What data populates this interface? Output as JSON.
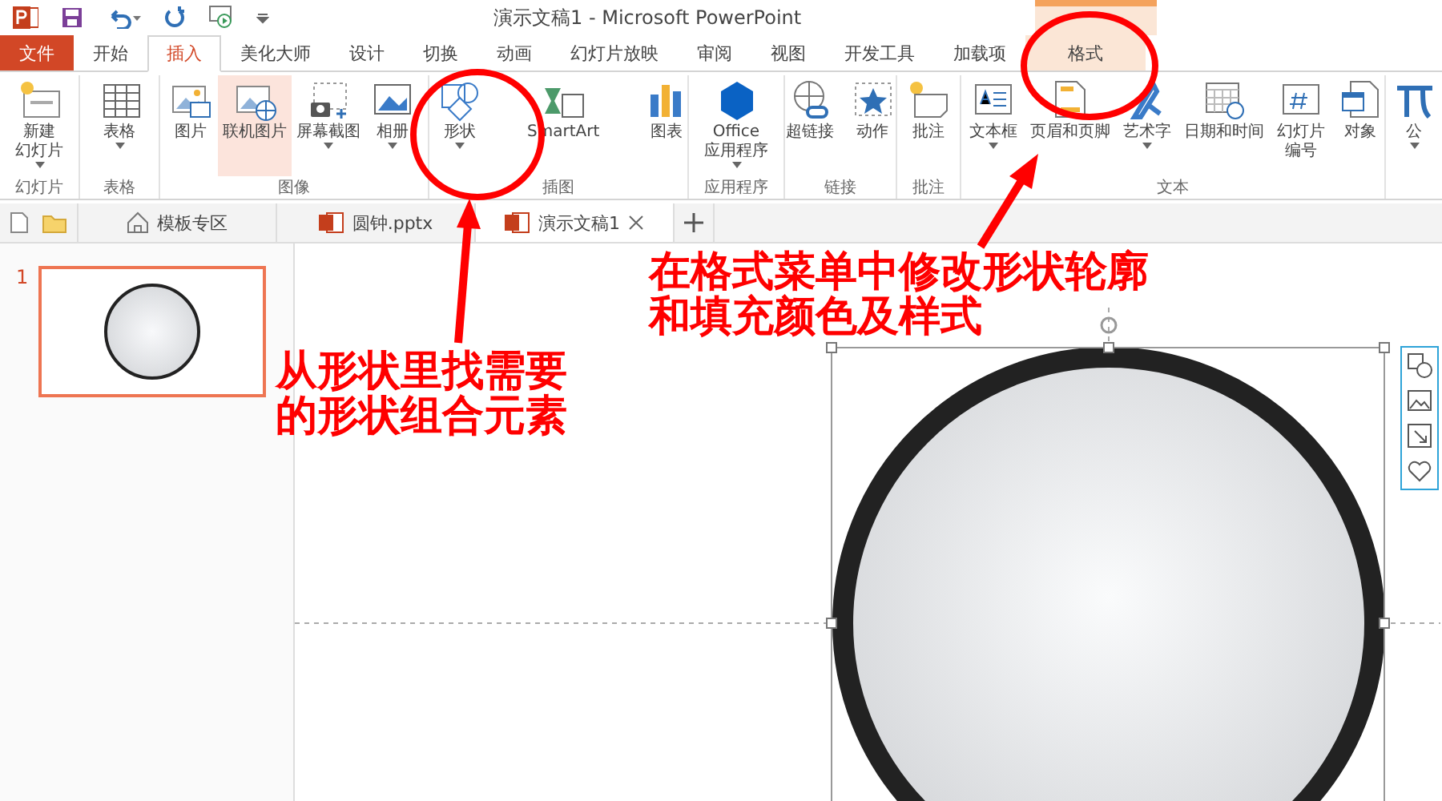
{
  "title_bar": {
    "title": "演示文稿1 - Microsoft PowerPoint"
  },
  "tabs": [
    {
      "label": "文件",
      "kind": "file",
      "selected": false
    },
    {
      "label": "开始",
      "kind": "normal",
      "selected": false
    },
    {
      "label": "插入",
      "kind": "normal",
      "selected": true
    },
    {
      "label": "美化大师",
      "kind": "normal",
      "selected": false
    },
    {
      "label": "设计",
      "kind": "normal",
      "selected": false
    },
    {
      "label": "切换",
      "kind": "normal",
      "selected": false
    },
    {
      "label": "动画",
      "kind": "normal",
      "selected": false
    },
    {
      "label": "幻灯片放映",
      "kind": "normal",
      "selected": false
    },
    {
      "label": "审阅",
      "kind": "normal",
      "selected": false
    },
    {
      "label": "视图",
      "kind": "normal",
      "selected": false
    },
    {
      "label": "开发工具",
      "kind": "normal",
      "selected": false
    },
    {
      "label": "加载项",
      "kind": "normal",
      "selected": false
    },
    {
      "label": "格式",
      "kind": "contextual",
      "selected": false
    }
  ],
  "ribbon_groups": [
    {
      "label": "幻灯片",
      "buttons": [
        {
          "label_lines": [
            "新建",
            "幻灯片"
          ],
          "kind": "new-slide",
          "dropdown": true,
          "highlighted": false
        }
      ]
    },
    {
      "label": "表格",
      "buttons": [
        {
          "label_lines": [
            "表格"
          ],
          "kind": "table",
          "dropdown": true,
          "highlighted": false
        }
      ]
    },
    {
      "label": "图像",
      "buttons": [
        {
          "label_lines": [
            "图片"
          ],
          "kind": "picture",
          "dropdown": false,
          "highlighted": false
        },
        {
          "label_lines": [
            "联机图片"
          ],
          "kind": "online-picture",
          "dropdown": false,
          "highlighted": true
        },
        {
          "label_lines": [
            "屏幕截图"
          ],
          "kind": "screenshot",
          "dropdown": true,
          "highlighted": false
        },
        {
          "label_lines": [
            "相册"
          ],
          "kind": "album",
          "dropdown": true,
          "highlighted": false
        }
      ]
    },
    {
      "label": "插图",
      "buttons": [
        {
          "label_lines": [
            "形状"
          ],
          "kind": "shapes",
          "dropdown": true,
          "highlighted": false
        },
        {
          "label_lines": [
            "SmartArt"
          ],
          "kind": "smartart",
          "dropdown": false,
          "highlighted": false
        },
        {
          "label_lines": [
            "图表"
          ],
          "kind": "chart",
          "dropdown": false,
          "highlighted": false
        }
      ]
    },
    {
      "label": "应用程序",
      "buttons": [
        {
          "label_lines": [
            "Office",
            "应用程序"
          ],
          "kind": "office",
          "dropdown": true,
          "highlighted": false
        }
      ]
    },
    {
      "label": "链接",
      "buttons": [
        {
          "label_lines": [
            "超链接"
          ],
          "kind": "link",
          "dropdown": false,
          "highlighted": false
        },
        {
          "label_lines": [
            "动作"
          ],
          "kind": "action",
          "dropdown": false,
          "highlighted": false
        }
      ]
    },
    {
      "label": "批注",
      "buttons": [
        {
          "label_lines": [
            "批注"
          ],
          "kind": "comment",
          "dropdown": false,
          "highlighted": false
        }
      ]
    },
    {
      "label": "文本",
      "buttons": [
        {
          "label_lines": [
            "文本框"
          ],
          "kind": "textbox",
          "dropdown": true,
          "highlighted": false
        },
        {
          "label_lines": [
            "页眉和页脚"
          ],
          "kind": "header",
          "dropdown": false,
          "highlighted": false
        },
        {
          "label_lines": [
            "艺术字"
          ],
          "kind": "wordart",
          "dropdown": true,
          "highlighted": false
        },
        {
          "label_lines": [
            "日期和时间"
          ],
          "kind": "date",
          "dropdown": false,
          "highlighted": false
        },
        {
          "label_lines": [
            "幻灯片",
            "编号"
          ],
          "kind": "number",
          "dropdown": false,
          "highlighted": false
        },
        {
          "label_lines": [
            "对象"
          ],
          "kind": "object",
          "dropdown": false,
          "highlighted": false
        }
      ]
    },
    {
      "buttons": [
        {
          "label_lines": [
            "公"
          ],
          "kind": "equation",
          "dropdown": true,
          "highlighted": false
        }
      ]
    }
  ],
  "doc_tabs": [
    {
      "label": "模板专区",
      "kind": "home",
      "selected": false,
      "closable": false
    },
    {
      "label": "圆钟.pptx",
      "kind": "ppt",
      "selected": false,
      "closable": false
    },
    {
      "label": "演示文稿1",
      "kind": "ppt",
      "selected": true,
      "closable": true
    }
  ],
  "slide_pane": {
    "slides": [
      {
        "number": "1",
        "selected": true
      }
    ]
  },
  "annotations": [
    {
      "lines": [
        "从形状里找需要",
        "的形状组合元素"
      ]
    },
    {
      "lines": [
        "在格式菜单中修改形状轮廓",
        "和填充颜色及样式"
      ]
    }
  ]
}
